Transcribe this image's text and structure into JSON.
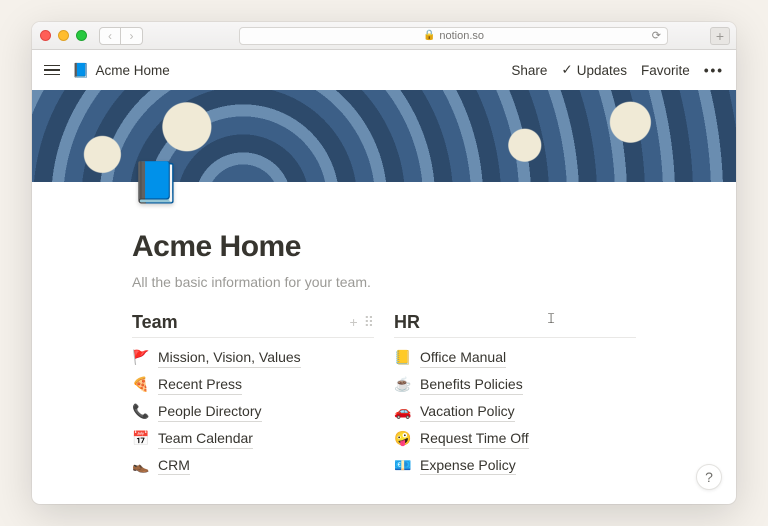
{
  "browser": {
    "url_host": "notion.so"
  },
  "topbar": {
    "breadcrumb_icon": "📘",
    "breadcrumb_title": "Acme Home",
    "share": "Share",
    "updates": "Updates",
    "favorite": "Favorite"
  },
  "page": {
    "icon": "📘",
    "title": "Acme Home",
    "description": "All the basic information for your team."
  },
  "columns": [
    {
      "heading": "Team",
      "show_controls": true,
      "items": [
        {
          "emoji": "🚩",
          "label": "Mission, Vision, Values"
        },
        {
          "emoji": "🍕",
          "label": "Recent Press"
        },
        {
          "emoji": "📞",
          "label": "People Directory"
        },
        {
          "emoji": "📅",
          "label": "Team Calendar"
        },
        {
          "emoji": "👞",
          "label": "CRM"
        }
      ]
    },
    {
      "heading": "HR",
      "show_controls": false,
      "items": [
        {
          "emoji": "📒",
          "label": "Office Manual"
        },
        {
          "emoji": "☕",
          "label": "Benefits Policies"
        },
        {
          "emoji": "🚗",
          "label": "Vacation Policy"
        },
        {
          "emoji": "🤪",
          "label": "Request Time Off"
        },
        {
          "emoji": "💶",
          "label": "Expense Policy"
        }
      ]
    }
  ],
  "help_label": "?"
}
